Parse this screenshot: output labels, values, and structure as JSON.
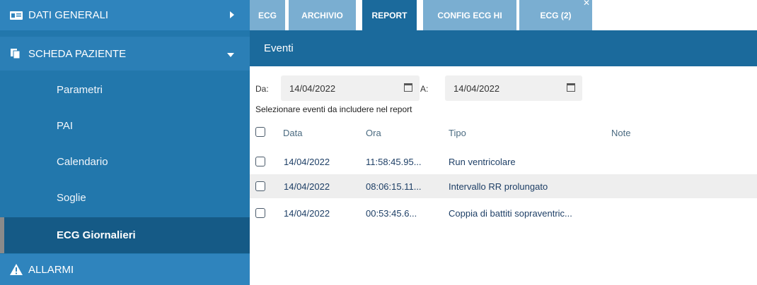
{
  "sidebar": {
    "dati_generali": "DATI GENERALI",
    "scheda_paziente": "SCHEDA PAZIENTE",
    "items": [
      {
        "label": "Parametri"
      },
      {
        "label": "PAI"
      },
      {
        "label": "Calendario"
      },
      {
        "label": "Soglie"
      },
      {
        "label": "ECG Giornalieri"
      }
    ],
    "allarmi": "ALLARMI"
  },
  "tabs": [
    {
      "label": "ECG"
    },
    {
      "label": "ARCHIVIO"
    },
    {
      "label": "REPORT"
    },
    {
      "label": "CONFIG ECG HI"
    },
    {
      "label": "ECG (2)"
    }
  ],
  "header": {
    "title": "Eventi"
  },
  "filter": {
    "from_label": "Da:",
    "from_value": "14/04/2022",
    "to_label": "A:",
    "to_value": "14/04/2022",
    "hint": "Selezionare eventi da includere nel report"
  },
  "table": {
    "columns": [
      "Data",
      "Ora",
      "Tipo",
      "Note"
    ],
    "rows": [
      {
        "data": "14/04/2022",
        "ora": "11:58:45.95...",
        "tipo": "Run ventricolare",
        "note": ""
      },
      {
        "data": "14/04/2022",
        "ora": "08:06:15.11...",
        "tipo": "Intervallo RR prolungato",
        "note": ""
      },
      {
        "data": "14/04/2022",
        "ora": "00:53:45.6...",
        "tipo": "Coppia di battiti sopraventric...",
        "note": ""
      }
    ]
  },
  "colors": {
    "sidebar": "#2277ac",
    "sidebar_active": "#155a86",
    "header": "#1b6a9c",
    "tab_inactive": "#7aaed1"
  }
}
